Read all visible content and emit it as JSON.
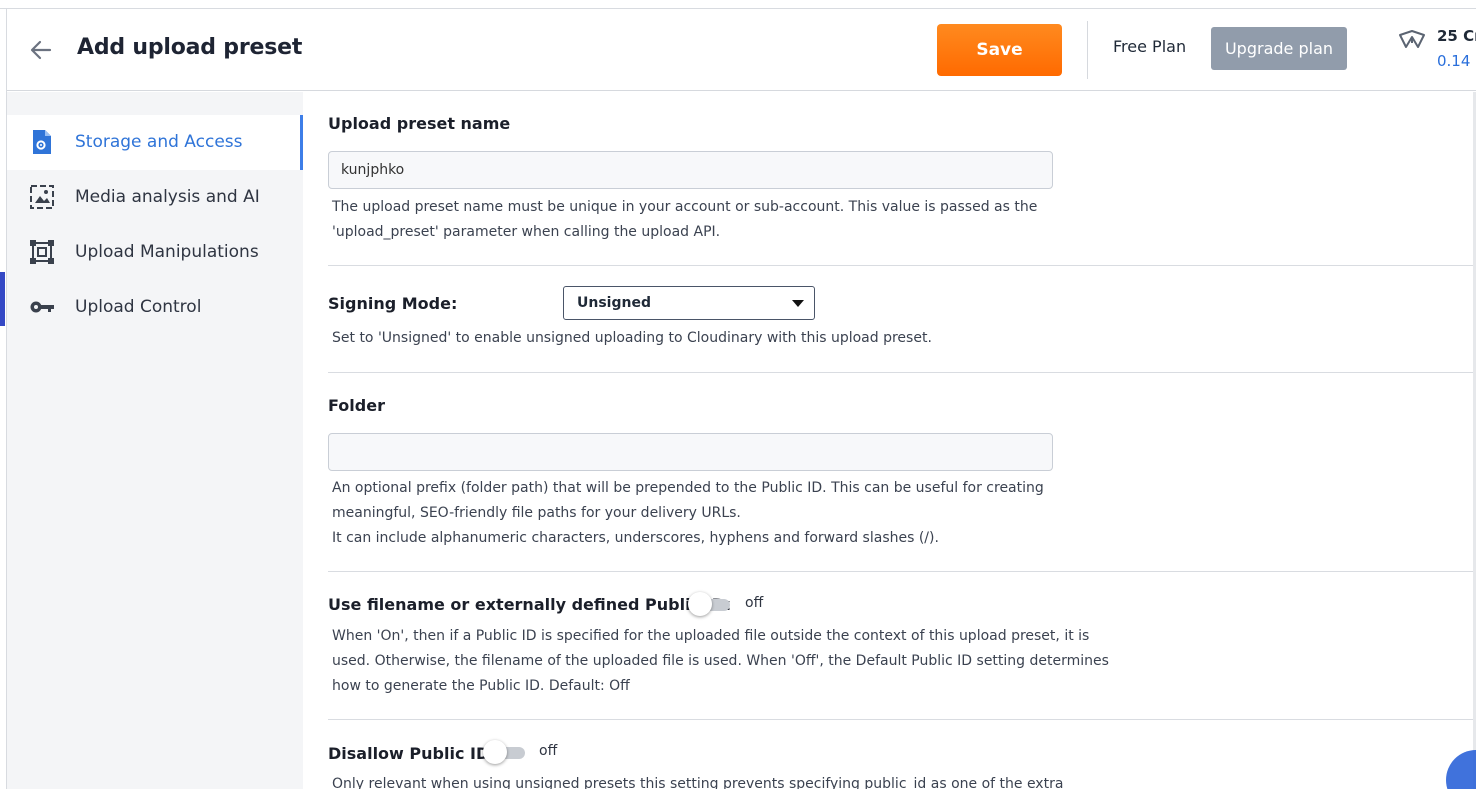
{
  "header": {
    "title": "Add upload preset",
    "save_label": "Save",
    "plan_label": "Free Plan",
    "upgrade_label": "Upgrade plan",
    "credits_title": "25 Cr",
    "credits_sub": "0.14 ("
  },
  "sidebar": {
    "items": [
      {
        "label": "Storage and Access",
        "icon": "file-settings-icon",
        "active": true
      },
      {
        "label": "Media analysis and AI",
        "icon": "image-frame-icon",
        "active": false
      },
      {
        "label": "Upload Manipulations",
        "icon": "crop-frame-icon",
        "active": false
      },
      {
        "label": "Upload Control",
        "icon": "key-icon",
        "active": false
      }
    ]
  },
  "form": {
    "preset_name": {
      "label": "Upload preset name",
      "value": "kunjphko",
      "help_1": "The upload preset name must be unique in your account or sub-account. This value is passed as the",
      "help_2": "'upload_preset' parameter when calling the upload API."
    },
    "signing_mode": {
      "label": "Signing Mode:",
      "value": "Unsigned",
      "help": "Set to 'Unsigned' to enable unsigned uploading to Cloudinary with this upload preset."
    },
    "folder": {
      "label": "Folder",
      "value": "",
      "help_1": "An optional prefix (folder path) that will be prepended to the Public ID. This can be useful for creating",
      "help_2": "meaningful, SEO-friendly file paths for your delivery URLs.",
      "help_3": "It can include alphanumeric characters, underscores, hyphens and forward slashes (/)."
    },
    "use_filename": {
      "label": "Use filename or externally defined Public ID:",
      "state": "off",
      "help_1": "When 'On', then if a Public ID is specified for the uploaded file outside the context of this upload preset, it is",
      "help_2": "used. Otherwise, the filename of the uploaded file is used. When 'Off', the Default Public ID setting determines",
      "help_3": "how to generate the Public ID. Default: Off"
    },
    "disallow_public_id": {
      "label": "Disallow Public ID:",
      "state": "off",
      "help_1": "Only relevant when using unsigned presets this setting prevents specifying public_id as one of the extra"
    }
  },
  "colors": {
    "save_button": "#ff6a00",
    "upgrade_button": "#919cab",
    "active_nav": "#2f74d8",
    "accent_bar": "#3448c5"
  }
}
